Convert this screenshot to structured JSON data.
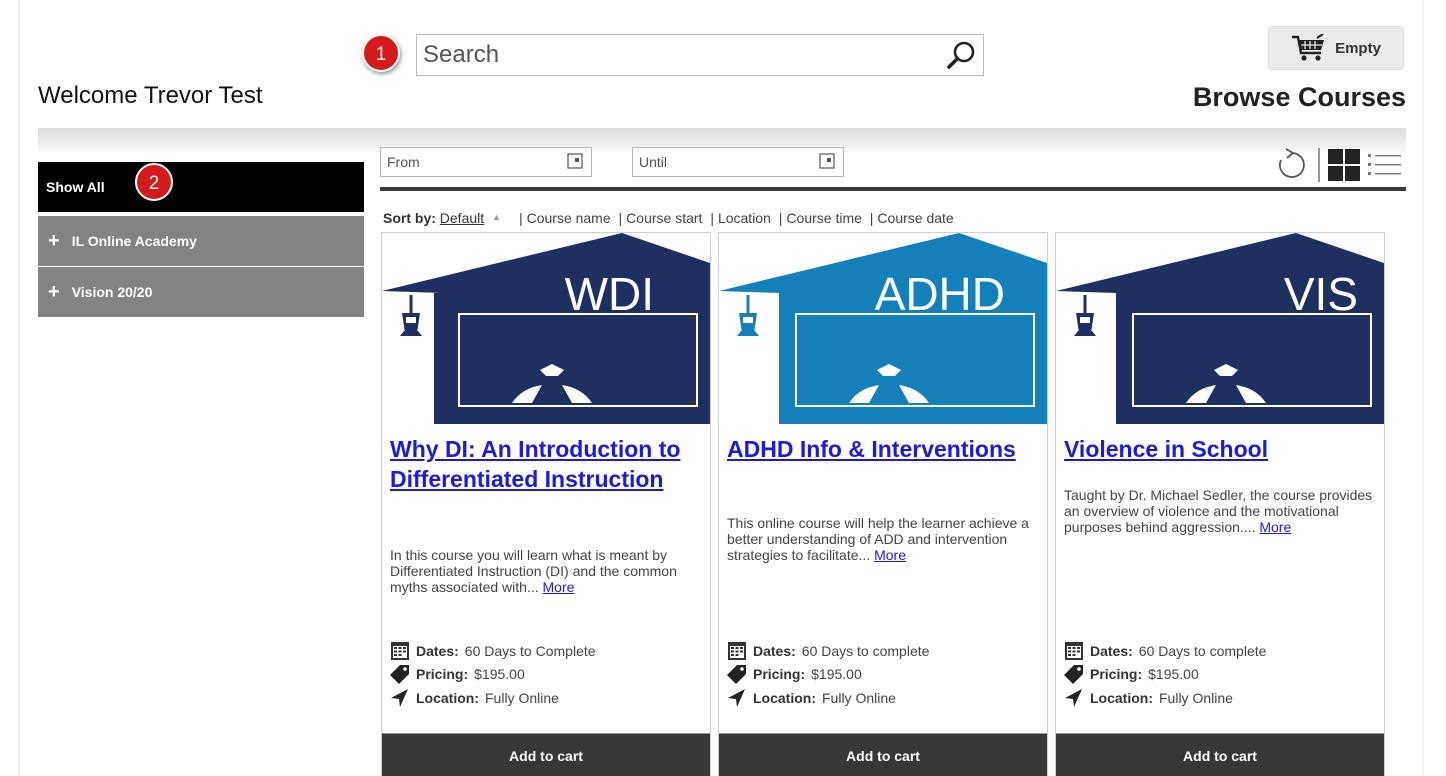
{
  "header": {
    "search_placeholder": "Search",
    "cart_label": "Empty",
    "welcome": "Welcome Trevor Test",
    "page_title": "Browse Courses"
  },
  "callouts": [
    "1",
    "2"
  ],
  "sidebar": {
    "items": [
      {
        "label": "Show All",
        "active": true
      },
      {
        "label": "IL Online Academy",
        "expandable": true
      },
      {
        "label": "Vision 20/20",
        "expandable": true
      }
    ]
  },
  "filters": {
    "from_placeholder": "From",
    "until_placeholder": "Until"
  },
  "sort": {
    "label": "Sort by:",
    "options": [
      "Default",
      "Course name",
      "Course start",
      "Location",
      "Course time",
      "Course date"
    ],
    "active": "Default"
  },
  "cards": [
    {
      "badge": "WDI",
      "title": "Why DI: An Introduction to Differentiated Instruction",
      "description": "In this course you will learn what is meant by Differentiated Instruction (DI) and the common myths associated with...",
      "more": "More",
      "dates_label": "Dates:",
      "dates": "60 Days to Complete",
      "pricing_label": "Pricing:",
      "pricing": "$195.00",
      "location_label": "Location:",
      "location": "Fully Online",
      "button": "Add to cart"
    },
    {
      "badge": "ADHD",
      "title": "ADHD Info & Interventions",
      "description": "This online course will help the learner achieve a better understanding of ADD and intervention strategies to facilitate...",
      "more": "More",
      "dates_label": "Dates:",
      "dates": "60 Days to complete",
      "pricing_label": "Pricing:",
      "pricing": "$195.00",
      "location_label": "Location:",
      "location": "Fully Online",
      "button": "Add to cart"
    },
    {
      "badge": "VIS",
      "title": "Violence in School",
      "description": "Taught by Dr. Michael Sedler, the course provides an overview of violence and the motivational purposes behind aggression....",
      "more": "More",
      "dates_label": "Dates:",
      "dates": "60 Days to complete",
      "pricing_label": "Pricing:",
      "pricing": "$195.00",
      "location_label": "Location:",
      "location": "Fully Online",
      "button": "Add to cart"
    }
  ],
  "colors": {
    "navy": "#1e3061",
    "teal": "#1380ba",
    "link": "#1a1ae6",
    "callout": "#d6191b",
    "sidebar_active": "#000000",
    "sidebar_category": "#838383",
    "cart_button": "#373737"
  },
  "icons": {
    "search": "magnifier-icon",
    "cart": "shopping-cart-icon",
    "calendar": "calendar-icon",
    "refresh": "refresh-icon",
    "grid_view": "grid-view-icon",
    "list_view": "list-view-icon",
    "dates": "calendar-icon",
    "pricing": "price-tag-icon",
    "location": "location-arrow-icon"
  }
}
